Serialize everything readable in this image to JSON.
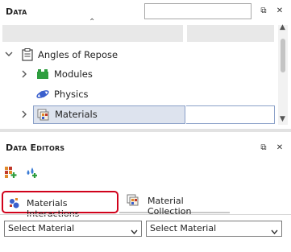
{
  "data_panel": {
    "title": "Data",
    "search_value": "",
    "tree": {
      "root": {
        "label": "Angles of Repose",
        "icon": "clipboard-icon"
      },
      "children": [
        {
          "label": "Modules",
          "icon": "modules-icon"
        },
        {
          "label": "Physics",
          "icon": "physics-icon"
        },
        {
          "label": "Materials",
          "icon": "materials-icon"
        }
      ]
    }
  },
  "editors_panel": {
    "title": "Data Editors",
    "tabs": [
      {
        "label": "Materials Interactions",
        "icon": "materials-interactions-icon"
      },
      {
        "label": "Material Collection",
        "icon": "material-collection-icon"
      }
    ],
    "select_left": "Select Material",
    "select_right": "Select Material"
  },
  "colors": {
    "highlight_ring": "#d0021b",
    "selected_row": "#dde3ee",
    "header_bg": "#e8e8e8",
    "modules_green": "#2f9e3f",
    "physics_blue": "#3a5fcd"
  }
}
